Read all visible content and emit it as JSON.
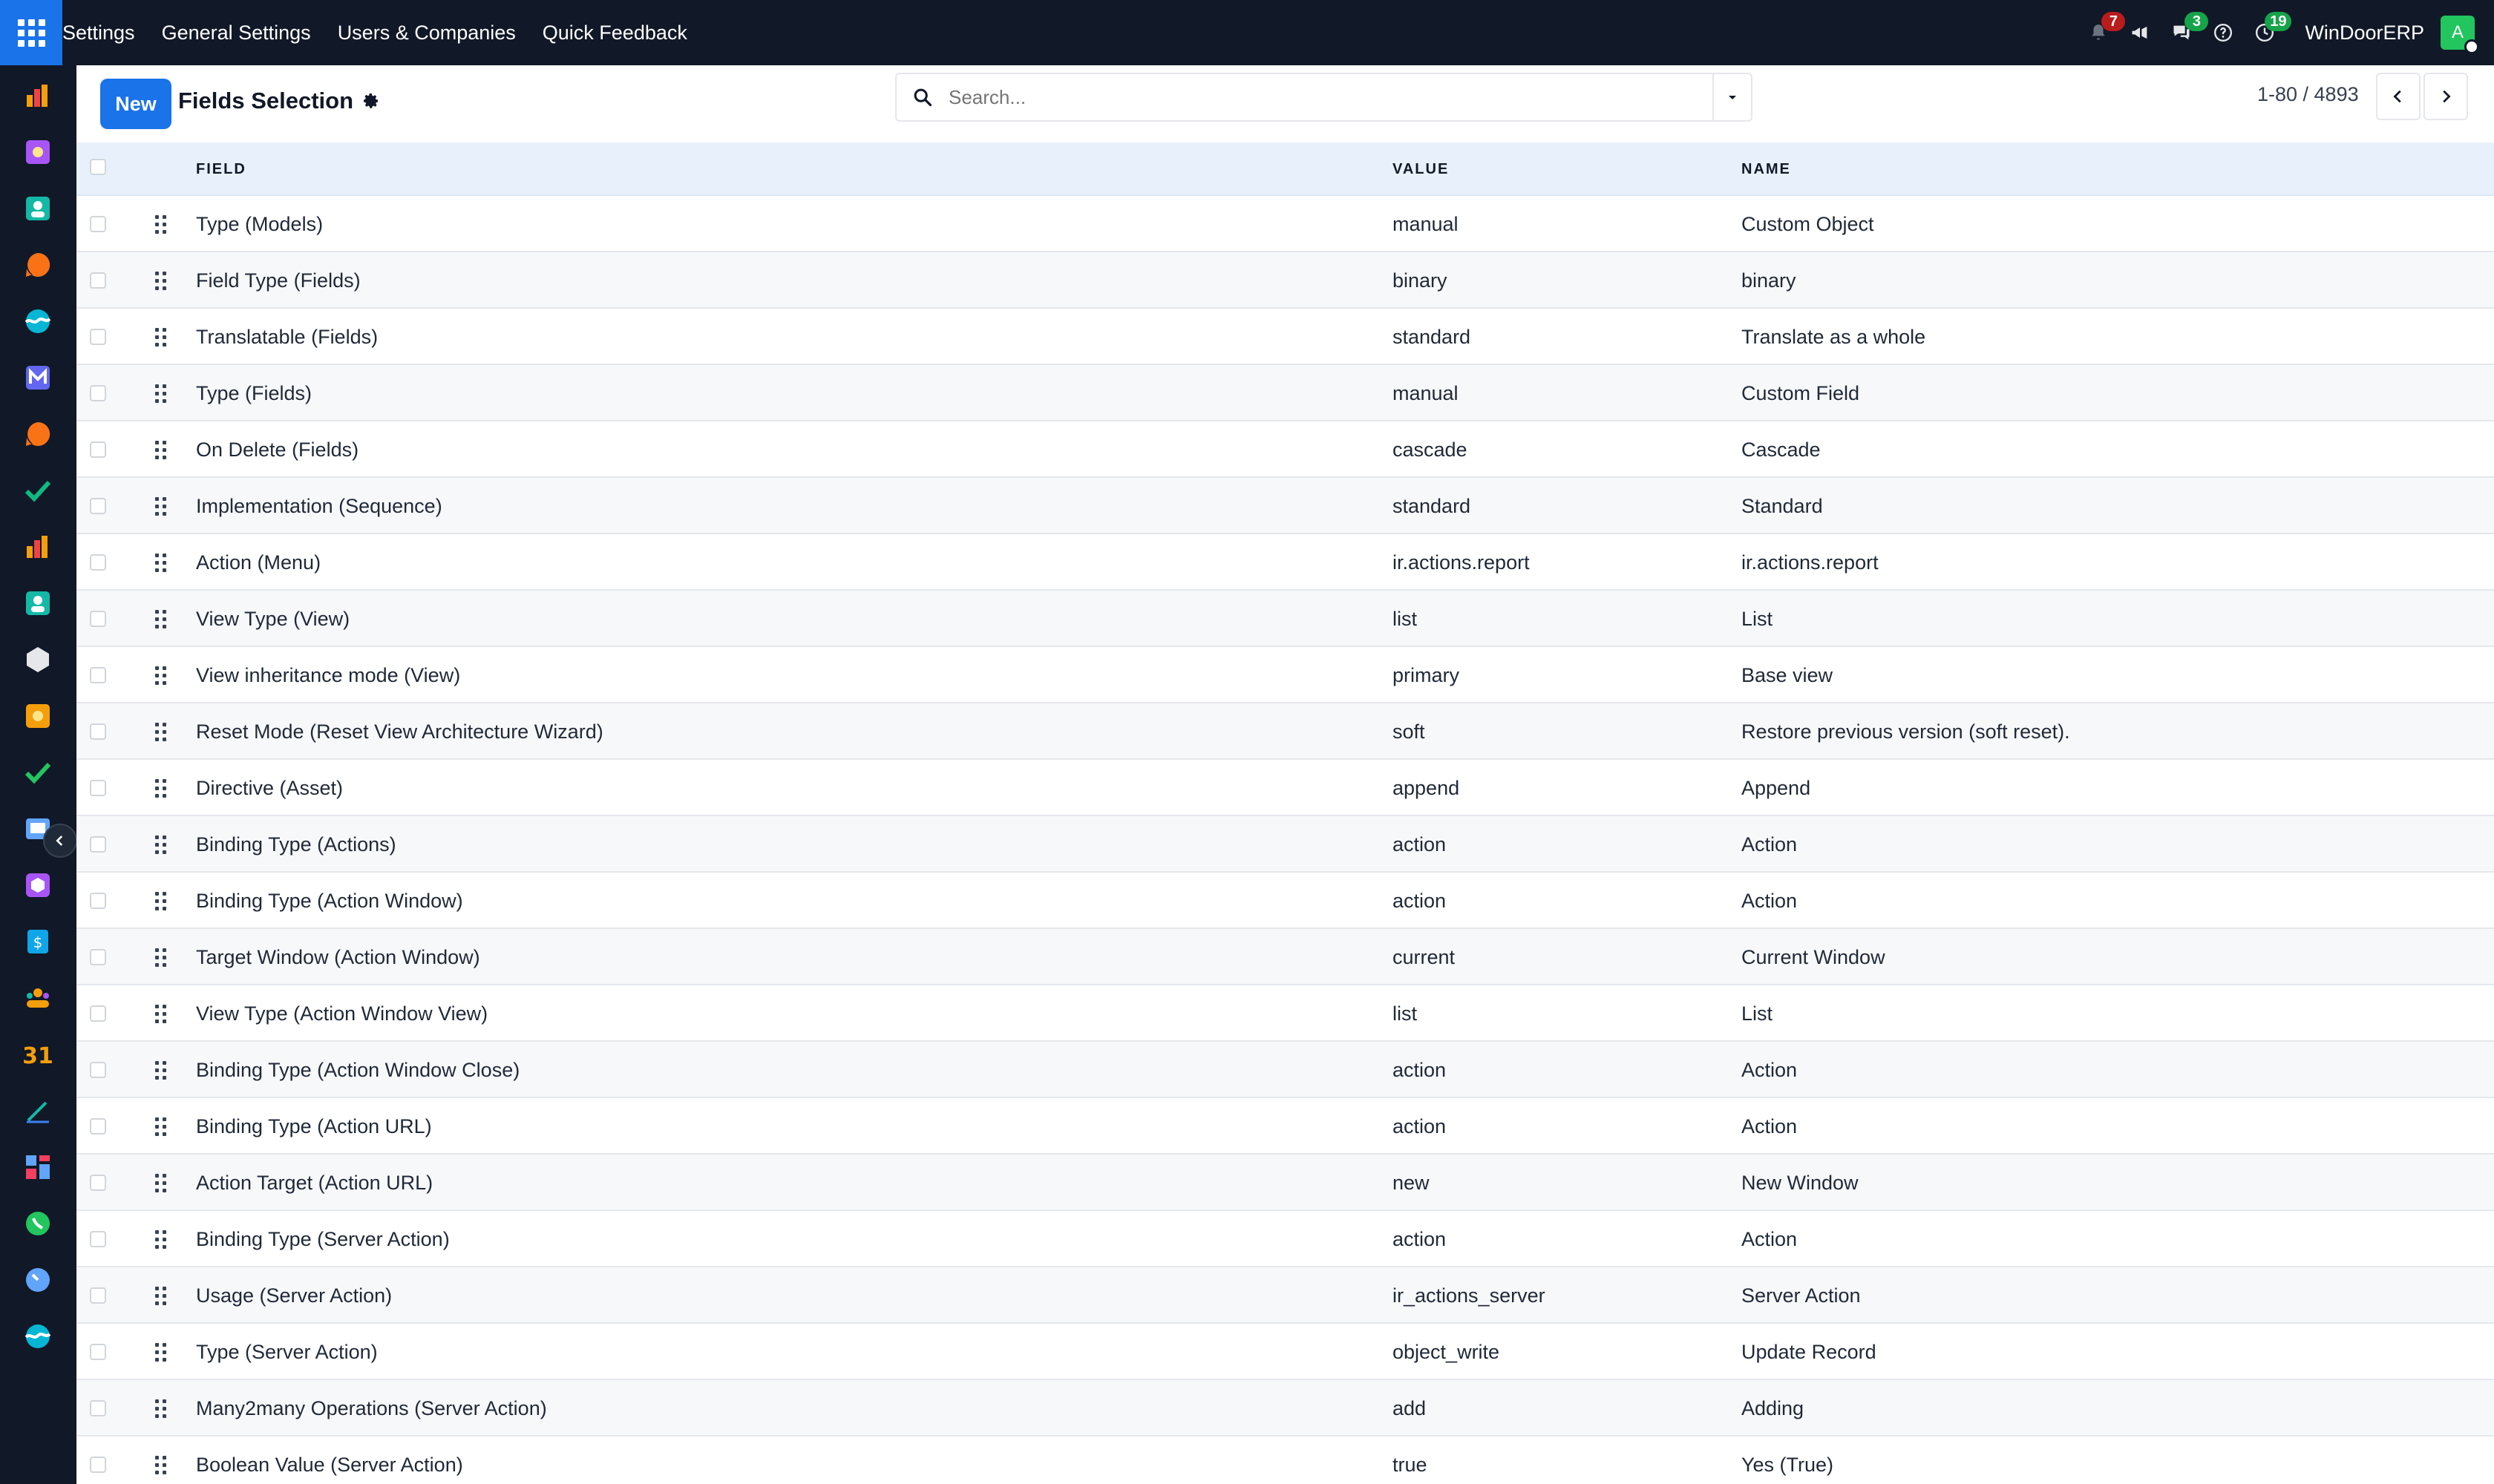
{
  "navbar": {
    "menu": [
      "Settings",
      "General Settings",
      "Users & Companies",
      "Quick Feedback"
    ],
    "notifications_count": "7",
    "messages_count": "3",
    "activities_count": "19",
    "company": "WinDoorERP",
    "avatar_letter": "A"
  },
  "control": {
    "new_label": "New",
    "title": "Fields Selection",
    "search_placeholder": "Search...",
    "pager": "1-80 / 4893"
  },
  "table": {
    "headers": {
      "field": "FIELD",
      "value": "VALUE",
      "name": "NAME"
    },
    "rows": [
      {
        "field": "Type (Models)",
        "value": "manual",
        "name": "Custom Object"
      },
      {
        "field": "Field Type (Fields)",
        "value": "binary",
        "name": "binary"
      },
      {
        "field": "Translatable (Fields)",
        "value": "standard",
        "name": "Translate as a whole"
      },
      {
        "field": "Type (Fields)",
        "value": "manual",
        "name": "Custom Field"
      },
      {
        "field": "On Delete (Fields)",
        "value": "cascade",
        "name": "Cascade"
      },
      {
        "field": "Implementation (Sequence)",
        "value": "standard",
        "name": "Standard"
      },
      {
        "field": "Action (Menu)",
        "value": "ir.actions.report",
        "name": "ir.actions.report"
      },
      {
        "field": "View Type (View)",
        "value": "list",
        "name": "List"
      },
      {
        "field": "View inheritance mode (View)",
        "value": "primary",
        "name": "Base view"
      },
      {
        "field": "Reset Mode (Reset View Architecture Wizard)",
        "value": "soft",
        "name": "Restore previous version (soft reset)."
      },
      {
        "field": "Directive (Asset)",
        "value": "append",
        "name": "Append"
      },
      {
        "field": "Binding Type (Actions)",
        "value": "action",
        "name": "Action"
      },
      {
        "field": "Binding Type (Action Window)",
        "value": "action",
        "name": "Action"
      },
      {
        "field": "Target Window (Action Window)",
        "value": "current",
        "name": "Current Window"
      },
      {
        "field": "View Type (Action Window View)",
        "value": "list",
        "name": "List"
      },
      {
        "field": "Binding Type (Action Window Close)",
        "value": "action",
        "name": "Action"
      },
      {
        "field": "Binding Type (Action URL)",
        "value": "action",
        "name": "Action"
      },
      {
        "field": "Action Target (Action URL)",
        "value": "new",
        "name": "New Window"
      },
      {
        "field": "Binding Type (Server Action)",
        "value": "action",
        "name": "Action"
      },
      {
        "field": "Usage (Server Action)",
        "value": "ir_actions_server",
        "name": "Server Action"
      },
      {
        "field": "Type (Server Action)",
        "value": "object_write",
        "name": "Update Record"
      },
      {
        "field": "Many2many Operations (Server Action)",
        "value": "add",
        "name": "Adding"
      },
      {
        "field": "Boolean Value (Server Action)",
        "value": "true",
        "name": "Yes (True)"
      }
    ]
  },
  "sidebar_apps": [
    {
      "icon": "dashboard-app-icon",
      "color": "#f59e0b"
    },
    {
      "icon": "studio-app-icon",
      "color": "#a855f7"
    },
    {
      "icon": "contacts-app-icon",
      "color": "#14b8a6"
    },
    {
      "icon": "discuss-app-icon",
      "color": "#f97316"
    },
    {
      "icon": "website-app-icon",
      "color": "#06b6d4"
    },
    {
      "icon": "email-marketing-app-icon",
      "color": "#6366f1"
    },
    {
      "icon": "livechat-app-icon",
      "color": "#f97316"
    },
    {
      "icon": "crm-app-icon",
      "color": "#10b981"
    },
    {
      "icon": "reporting-app-icon",
      "color": "#f59e0b"
    },
    {
      "icon": "employees-app-icon",
      "color": "#14b8a6"
    },
    {
      "icon": "inventory-app-icon",
      "color": "#e5e7eb"
    },
    {
      "icon": "planning-app-icon",
      "color": "#f59e0b"
    },
    {
      "icon": "project-app-icon",
      "color": "#22c55e"
    },
    {
      "icon": "knowledge-app-icon",
      "color": "#60a5fa"
    },
    {
      "icon": "modules-app-icon",
      "color": "#a855f7"
    },
    {
      "icon": "invoicing-app-icon",
      "color": "#0ea5e9"
    },
    {
      "icon": "team-app-icon",
      "color": "#f59e0b"
    },
    {
      "icon": "calendar-app-icon",
      "color": "#f59e0b"
    },
    {
      "icon": "sign-app-icon",
      "color": "#14b8a6"
    },
    {
      "icon": "apps-app-icon",
      "color": "#60a5fa"
    },
    {
      "icon": "whatsapp-app-icon",
      "color": "#22c55e"
    },
    {
      "icon": "timesheet-app-icon",
      "color": "#60a5fa"
    },
    {
      "icon": "website-builder-app-icon",
      "color": "#06b6d4"
    }
  ]
}
